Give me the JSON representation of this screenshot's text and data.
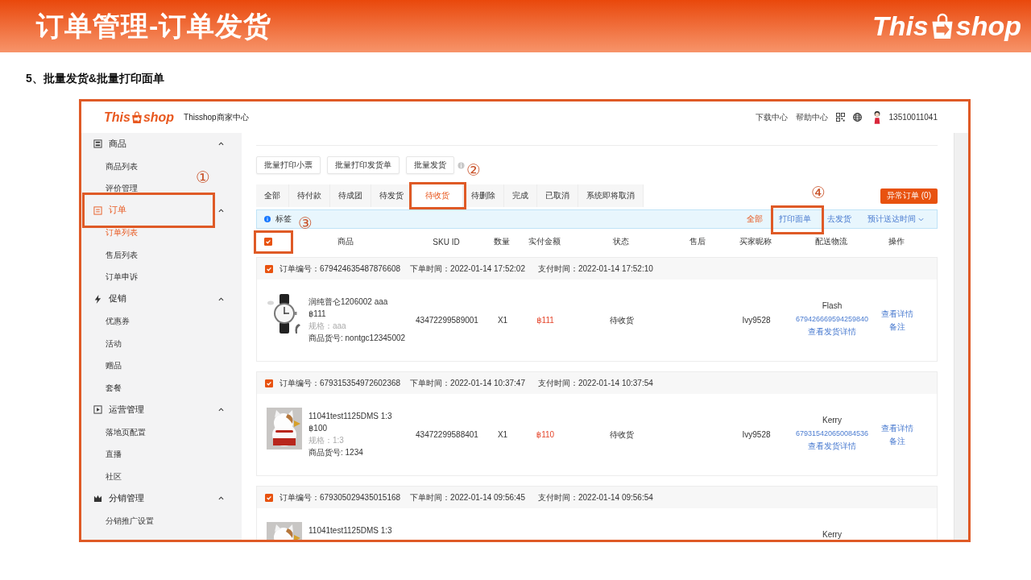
{
  "slide": {
    "title": "订单管理-订单发货",
    "logo": {
      "left": "This",
      "right": "shop"
    },
    "subtitle": "5、批量发货&批量打印面单"
  },
  "app": {
    "logo": {
      "left": "This",
      "right": "shop"
    },
    "center_title": "Thisshop商家中心",
    "top_links": [
      "下载中心",
      "帮助中心"
    ],
    "phone": "13510011041"
  },
  "sidebar": {
    "groups": [
      {
        "kind": "goods",
        "label": "商品",
        "expanded": true,
        "selected": false,
        "children": [
          {
            "label": "商品列表",
            "selected": false
          },
          {
            "label": "评价管理",
            "selected": false
          }
        ]
      },
      {
        "kind": "order",
        "label": "订单",
        "expanded": true,
        "selected": true,
        "step": "①",
        "children": [
          {
            "label": "订单列表",
            "selected": true
          },
          {
            "label": "售后列表",
            "selected": false
          },
          {
            "label": "订单申诉",
            "selected": false
          }
        ]
      },
      {
        "kind": "promo",
        "label": "促销",
        "expanded": true,
        "selected": false,
        "children": [
          {
            "label": "优惠券",
            "selected": false
          },
          {
            "label": "活动",
            "selected": false
          },
          {
            "label": "赠品",
            "selected": false
          },
          {
            "label": "套餐",
            "selected": false
          }
        ]
      },
      {
        "kind": "ops",
        "label": "运营管理",
        "expanded": true,
        "selected": false,
        "children": [
          {
            "label": "落地页配置",
            "selected": false
          },
          {
            "label": "直播",
            "selected": false
          },
          {
            "label": "社区",
            "selected": false
          }
        ]
      },
      {
        "kind": "dist",
        "label": "分销管理",
        "expanded": true,
        "selected": false,
        "children": [
          {
            "label": "分销推广设置",
            "selected": false
          }
        ]
      }
    ]
  },
  "batch_buttons": [
    "批量打印小票",
    "批量打印发货单",
    "批量发货"
  ],
  "tabs": [
    {
      "label": "全部",
      "selected": false
    },
    {
      "label": "待付款",
      "selected": false
    },
    {
      "label": "待成团",
      "selected": false
    },
    {
      "label": "待发货",
      "selected": false
    },
    {
      "label": "待收货",
      "selected": true,
      "step": "②"
    },
    {
      "label": "待删除",
      "selected": false
    },
    {
      "label": "完成",
      "selected": false
    },
    {
      "label": "已取消",
      "selected": false
    },
    {
      "label": "系统即将取消",
      "selected": false
    }
  ],
  "abnormal_button": "异常订单 (0)",
  "filter_bar": {
    "tag": "标签",
    "links": [
      {
        "kind": "link",
        "label": "全部",
        "selected": true
      },
      {
        "kind": "link",
        "label": "打印面单",
        "selected": false,
        "step": "④"
      },
      {
        "kind": "link",
        "label": "去发货",
        "selected": false
      },
      {
        "kind": "dropdown",
        "label": "预计送达时间",
        "selected": false
      }
    ]
  },
  "table": {
    "select_all": {
      "checked": true,
      "step": "③"
    },
    "columns": [
      "商品",
      "SKU ID",
      "数量",
      "实付金额",
      "状态",
      "售后",
      "买家昵称",
      "配送物流",
      "操作"
    ]
  },
  "orders": [
    {
      "checked": true,
      "number": "订单编号：679424635487876608",
      "order_time": "下单时间：2022-01-14 17:52:02",
      "pay_time": "支付时间：2022-01-14 17:52:10",
      "product": {
        "name": "润纯普仑1206002 aaa",
        "price": "฿111",
        "spec": "规格：aaa",
        "code": "商品货号: nontgc12345002"
      },
      "sku": "43472299589001",
      "qty": "X1",
      "amount": "฿111",
      "status": "待收货",
      "buyer": "Ivy9528",
      "carrier": "Flash",
      "tracking": "679426669594259840",
      "shipping_detail": "查看发货详情",
      "actions": [
        "查看详情",
        "备注"
      ]
    },
    {
      "checked": true,
      "number": "订单编号：679315354972602368",
      "order_time": "下单时间：2022-01-14 10:37:47",
      "pay_time": "支付时间：2022-01-14 10:37:54",
      "product": {
        "name": "11041test1125DMS 1:3",
        "price": "฿100",
        "spec": "规格：1:3",
        "code": "商品货号: 1234"
      },
      "sku": "43472299588401",
      "qty": "X1",
      "amount": "฿110",
      "status": "待收货",
      "buyer": "Ivy9528",
      "carrier": "Kerry",
      "tracking": "679315420650084536",
      "shipping_detail": "查看发货详情",
      "actions": [
        "查看详情",
        "备注"
      ]
    },
    {
      "checked": true,
      "number": "订单编号：679305029435015168",
      "order_time": "下单时间：2022-01-14 09:56:45",
      "pay_time": "支付时间：2022-01-14 09:56:54",
      "product": {
        "name": "11041test1125DMS 1:3"
      },
      "carrier": "Kerry"
    }
  ]
}
